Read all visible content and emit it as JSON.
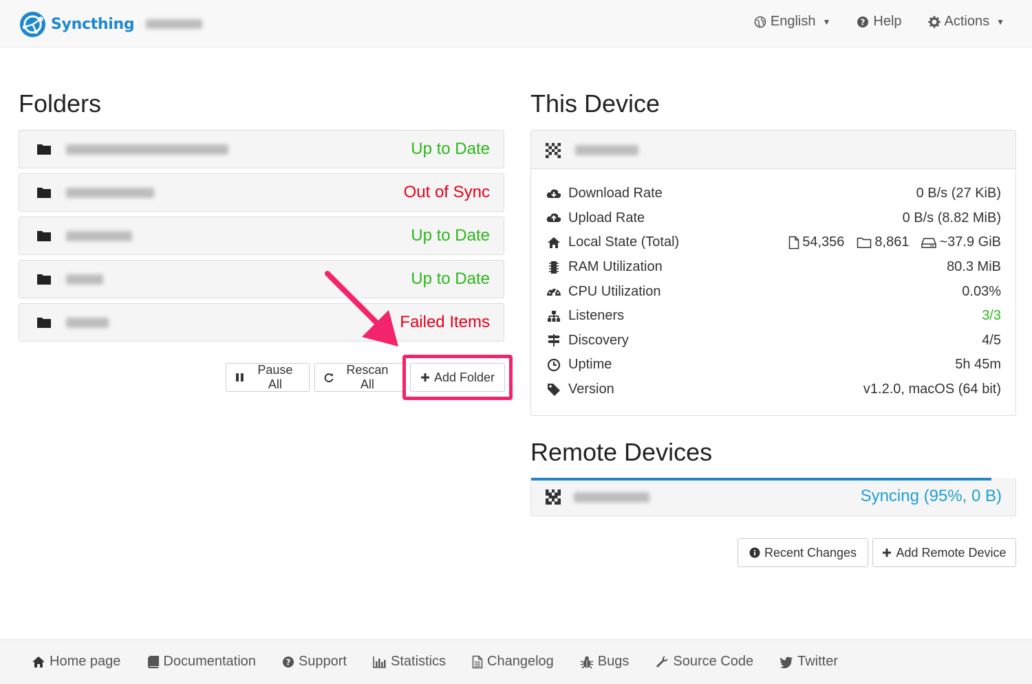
{
  "navbar": {
    "brand": "Syncthing",
    "language": "English",
    "help": "Help",
    "actions": "Actions",
    "icons": {
      "language": "globe-icon",
      "help": "question-circle-icon",
      "actions": "gear-icon"
    }
  },
  "folders": {
    "heading": "Folders",
    "items": [
      {
        "status": "Up to Date",
        "status_color": "#2bb71c",
        "name_blur_width": 236
      },
      {
        "status": "Out of Sync",
        "status_color": "#e8001c",
        "name_blur_width": 128
      },
      {
        "status": "Up to Date",
        "status_color": "#2bb71c",
        "name_blur_width": 96
      },
      {
        "status": "Up to Date",
        "status_color": "#2bb71c",
        "name_blur_width": 54
      },
      {
        "status": "Failed Items",
        "status_color": "#e8001c",
        "name_blur_width": 62
      }
    ],
    "buttons": {
      "pause_all": "Pause All",
      "rescan_all": "Rescan All",
      "add_folder": "Add Folder"
    }
  },
  "this_device": {
    "heading": "This Device",
    "stats": [
      {
        "label": "Download Rate",
        "value": "0 B/s (27 KiB)",
        "icon": "cloud-download-icon"
      },
      {
        "label": "Upload Rate",
        "value": "0 B/s (8.82 MiB)",
        "icon": "cloud-upload-icon"
      },
      {
        "label": "Local State (Total)",
        "files": "54,356",
        "dirs": "8,861",
        "size": "~37.9 GiB",
        "icon": "home-icon"
      },
      {
        "label": "RAM Utilization",
        "value": "80.3 MiB",
        "icon": "memory-chip-icon"
      },
      {
        "label": "CPU Utilization",
        "value": "0.03%",
        "icon": "dashboard-icon"
      },
      {
        "label": "Listeners",
        "value": "3/3",
        "icon": "sitemap-icon",
        "value_color": "#2bb71c"
      },
      {
        "label": "Discovery",
        "value": "4/5",
        "icon": "signpost-icon"
      },
      {
        "label": "Uptime",
        "value": "5h 45m",
        "icon": "clock-icon"
      },
      {
        "label": "Version",
        "value": "v1.2.0, macOS (64 bit)",
        "icon": "tag-icon"
      }
    ]
  },
  "remote_devices": {
    "heading": "Remote Devices",
    "items": [
      {
        "status": "Syncing (95%, 0 B)",
        "progress": 0.95
      }
    ],
    "buttons": {
      "recent_changes": "Recent Changes",
      "add_remote_device": "Add Remote Device"
    }
  },
  "footer": {
    "links": [
      {
        "label": "Home page",
        "icon": "home-icon"
      },
      {
        "label": "Documentation",
        "icon": "book-icon"
      },
      {
        "label": "Support",
        "icon": "question-circle-icon"
      },
      {
        "label": "Statistics",
        "icon": "bar-chart-icon"
      },
      {
        "label": "Changelog",
        "icon": "file-text-icon"
      },
      {
        "label": "Bugs",
        "icon": "bug-icon"
      },
      {
        "label": "Source Code",
        "icon": "wrench-icon"
      },
      {
        "label": "Twitter",
        "icon": "twitter-icon"
      }
    ]
  },
  "colors": {
    "accent": "#1e88cf",
    "highlight": "#f2246b"
  }
}
